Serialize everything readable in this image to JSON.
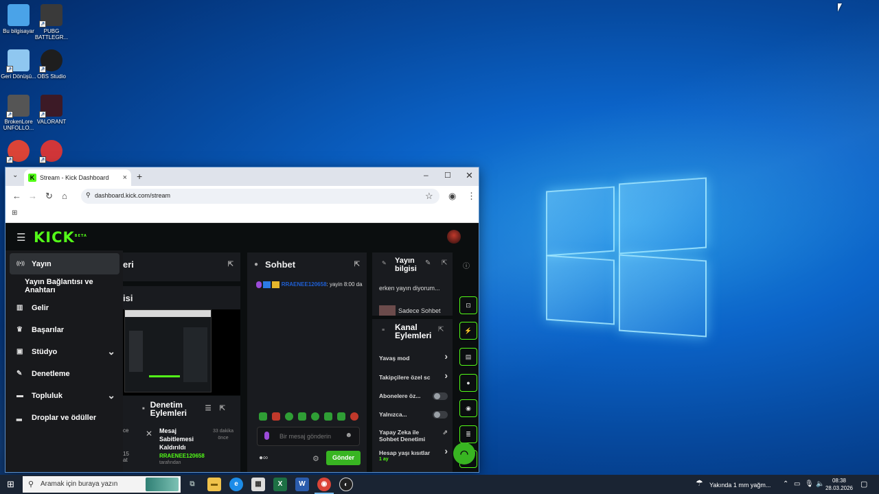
{
  "desktop": {
    "icons": [
      {
        "label": "Bu bilgisayar",
        "icon": "computer-icon",
        "color": "#4aa3e8"
      },
      {
        "label": "PUBG BATTLEGR...",
        "icon": "pubg-icon",
        "color": "#3a3a3a"
      },
      {
        "label": "Geri Dönüşü...",
        "icon": "recycle-bin-icon",
        "color": "#8fc7f0"
      },
      {
        "label": "OBS Studio",
        "icon": "obs-icon",
        "color": "#1e1e1e"
      },
      {
        "label": "BrokenLore UNFOLLO...",
        "icon": "game-icon",
        "color": "#555555"
      },
      {
        "label": "VALORANT",
        "icon": "valorant-icon",
        "color": "#3c1a26"
      },
      {
        "label": "",
        "icon": "chrome-icon",
        "color": "#db4437"
      },
      {
        "label": "",
        "icon": "riot-icon",
        "color": "#d13639"
      }
    ]
  },
  "browser": {
    "tab_title": "Stream - Kick Dashboard",
    "url": "dashboard.kick.com/stream",
    "new_tab": "+",
    "close_tab": "×"
  },
  "kick": {
    "logo": "KICK",
    "logo_badge": "BETA",
    "sidebar": [
      {
        "label": "Yayın",
        "icon": "broadcast-icon",
        "active": true,
        "chevron": false
      },
      {
        "label": "Yayın Bağlantısı ve Anahtarı",
        "icon": "",
        "active": false,
        "chevron": false
      },
      {
        "label": "Gelir",
        "icon": "revenue-icon",
        "active": false,
        "chevron": false
      },
      {
        "label": "Başarılar",
        "icon": "trophy-icon",
        "active": false,
        "chevron": false
      },
      {
        "label": "Stüdyo",
        "icon": "studio-icon",
        "active": false,
        "chevron": true
      },
      {
        "label": "Denetleme",
        "icon": "wrench-icon",
        "active": false,
        "chevron": false
      },
      {
        "label": "Topluluk",
        "icon": "community-icon",
        "active": false,
        "chevron": true
      },
      {
        "label": "Droplar ve ödüller",
        "icon": "drops-icon",
        "active": false,
        "chevron": false
      }
    ],
    "partial_heads": {
      "top": "eri",
      "second": "isi"
    },
    "moderation": {
      "title": "Denetim Eylemleri",
      "event_title": "Mesaj Sabitlemesi Kaldırıldı",
      "user": "RRAENEE120658",
      "by": "tarafından",
      "time": "33 dakika önce",
      "left_cut_1": "ce",
      "left_cut_2": "15 at"
    },
    "chat": {
      "title": "Sohbet",
      "message_user": "RRAENEE120658",
      "message_text": ": yayin 8:00 da",
      "input_placeholder": "Bir mesaj gönderin",
      "send_label": "Gönder"
    },
    "stream_info": {
      "title": "Yayın bilgisi",
      "stream_title": "erken yayın diyorum...",
      "category": "Sadece Sohbet"
    },
    "channel_actions": {
      "title": "Kanal Eylemleri",
      "items": [
        {
          "label": "Yavaş mod",
          "control": "chevron"
        },
        {
          "label": "Takipçilere özel sc",
          "control": "chevron"
        },
        {
          "label": "Abonelere öz...",
          "control": "toggle"
        },
        {
          "label": "Yalnızca...",
          "control": "toggle"
        },
        {
          "label": "Yapay Zeka ile Sohbet Denetimi",
          "control": "external"
        },
        {
          "label": "Hesap yaşı kısıtlar",
          "sub": "1 ay",
          "control": "chevron"
        }
      ]
    },
    "accent": "#53fc18"
  },
  "taskbar": {
    "search_placeholder": "Aramak için buraya yazın",
    "weather": "Yakında 1 mm yağm...",
    "time": "08:38",
    "date": "28.03.2026"
  }
}
